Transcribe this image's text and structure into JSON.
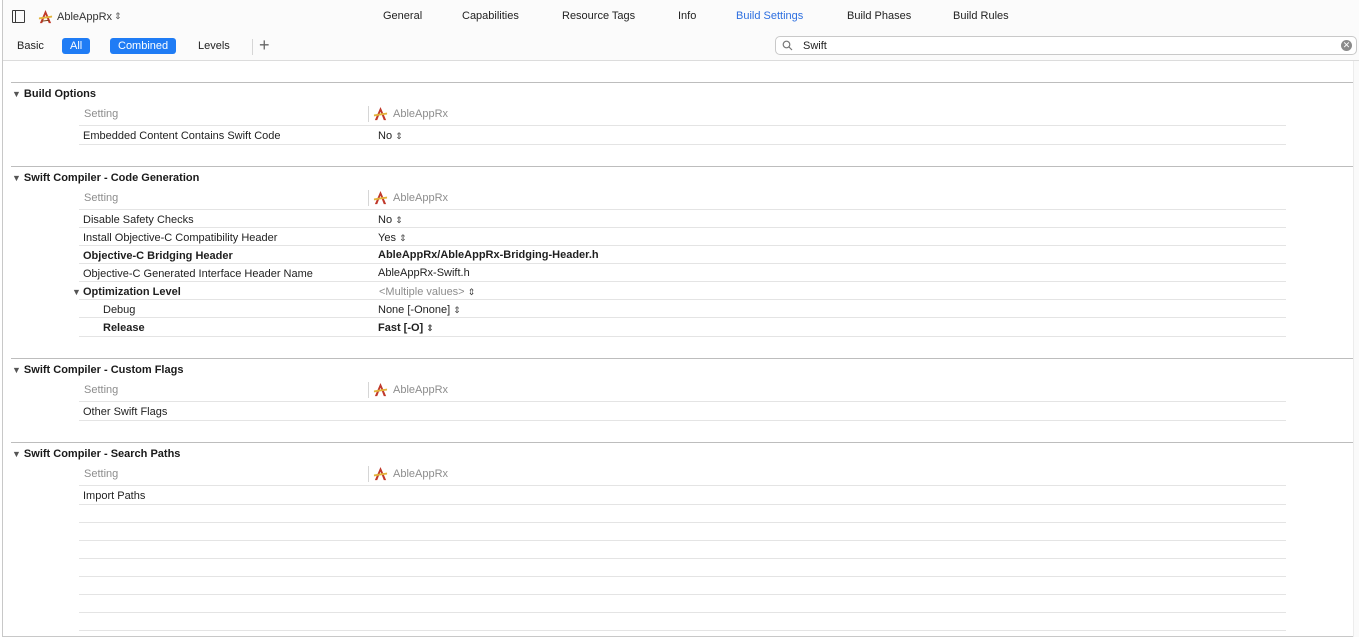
{
  "toolbar": {
    "target_name": "AbleAppRx",
    "tabs": [
      "General",
      "Capabilities",
      "Resource Tags",
      "Info",
      "Build Settings",
      "Build Phases",
      "Build Rules"
    ],
    "active_tab": "Build Settings"
  },
  "filterbar": {
    "basic": "Basic",
    "all": "All",
    "combined": "Combined",
    "levels": "Levels",
    "search_value": "Swift"
  },
  "column_header": {
    "setting": "Setting",
    "target": "AbleAppRx"
  },
  "sections": [
    {
      "title": "Build Options",
      "rows": [
        {
          "label": "Embedded Content Contains Swift Code",
          "value": "No"
        }
      ]
    },
    {
      "title": "Swift Compiler - Code Generation",
      "rows": [
        {
          "label": "Disable Safety Checks",
          "value": "No"
        },
        {
          "label": "Install Objective-C Compatibility Header",
          "value": "Yes"
        },
        {
          "label": "Objective-C Bridging Header",
          "value": "AbleAppRx/AbleAppRx-Bridging-Header.h"
        },
        {
          "label": "Objective-C Generated Interface Header Name",
          "value": "AbleAppRx-Swift.h"
        },
        {
          "label": "Optimization Level",
          "value": "<Multiple values>"
        },
        {
          "label": "Debug",
          "value": "None [-Onone]"
        },
        {
          "label": "Release",
          "value": "Fast [-O]"
        }
      ]
    },
    {
      "title": "Swift Compiler - Custom Flags",
      "rows": [
        {
          "label": "Other Swift Flags",
          "value": ""
        }
      ]
    },
    {
      "title": "Swift Compiler - Search Paths",
      "rows": [
        {
          "label": "Import Paths",
          "value": ""
        }
      ]
    }
  ],
  "colors": {
    "accent": "#1f7cf5",
    "active_tab": "#2d6fe0"
  }
}
